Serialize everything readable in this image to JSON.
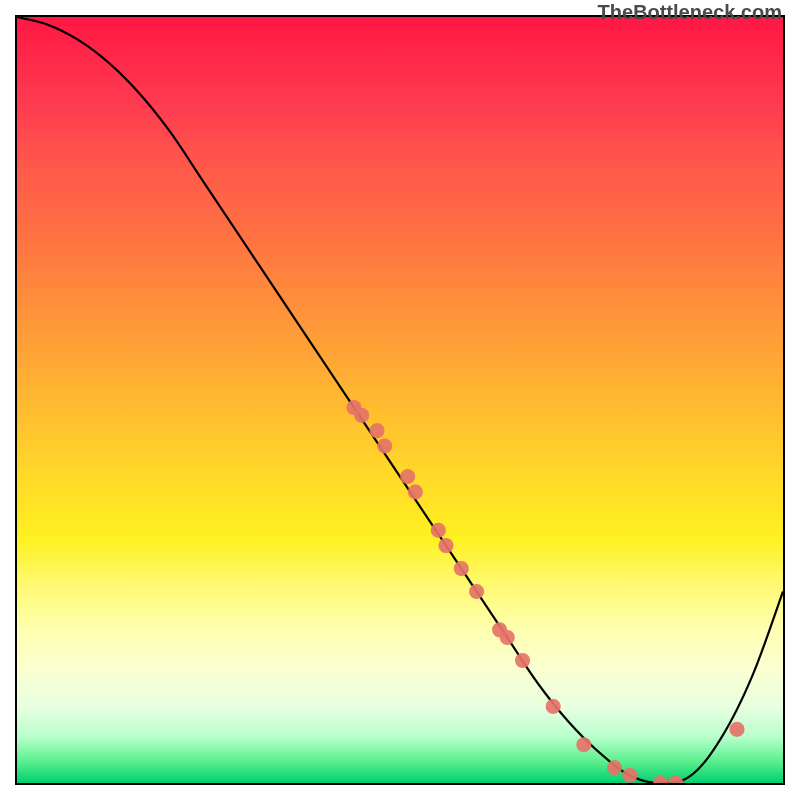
{
  "attribution": "TheBottleneck.com",
  "chart_data": {
    "type": "line",
    "title": "",
    "xlabel": "",
    "ylabel": "",
    "xlim": [
      0,
      100
    ],
    "ylim": [
      0,
      100
    ],
    "series": [
      {
        "name": "bottleneck-curve",
        "x": [
          0,
          4,
          8,
          12,
          16,
          20,
          24,
          28,
          32,
          36,
          40,
          44,
          48,
          52,
          56,
          60,
          64,
          68,
          72,
          76,
          80,
          84,
          88,
          92,
          96,
          100
        ],
        "y": [
          100,
          99,
          97,
          94,
          90,
          85,
          79,
          73,
          67,
          61,
          55,
          49,
          43,
          37,
          31,
          25,
          19,
          13,
          8,
          4,
          1,
          0,
          1,
          6,
          14,
          25
        ]
      }
    ],
    "scatter_points": {
      "name": "data-points",
      "x": [
        44,
        45,
        47,
        48,
        51,
        52,
        55,
        56,
        58,
        60,
        63,
        64,
        66,
        70,
        74,
        78,
        80,
        84,
        86,
        94
      ],
      "y": [
        49,
        48,
        46,
        44,
        40,
        38,
        33,
        31,
        28,
        25,
        20,
        19,
        16,
        10,
        5,
        2,
        1,
        0,
        0,
        7
      ]
    }
  }
}
